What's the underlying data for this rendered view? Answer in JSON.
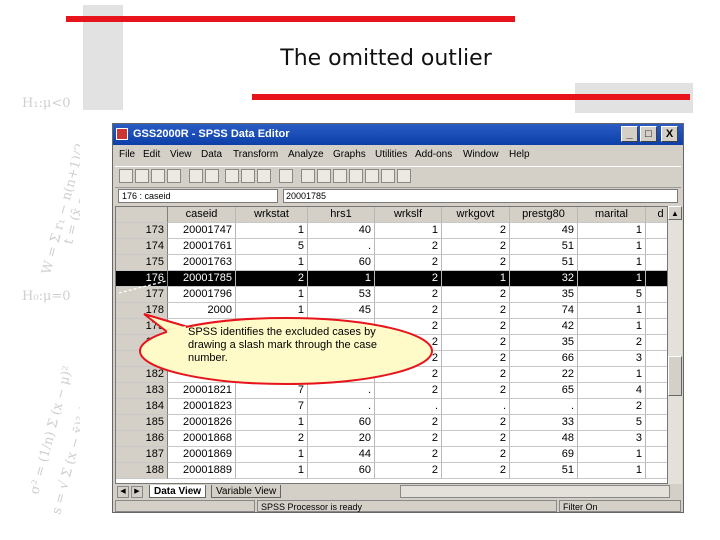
{
  "slide": {
    "title": "The omitted outlier"
  },
  "window": {
    "title": "GSS2000R - SPSS Data Editor",
    "controls": {
      "minimize": "_",
      "maximize": "□",
      "close": "X"
    }
  },
  "menu": [
    "File",
    "Edit",
    "View",
    "Data",
    "Transform",
    "Analyze",
    "Graphs",
    "Utilities",
    "Add-ons",
    "Window",
    "Help"
  ],
  "editor": {
    "cell_ref": "176 : caseid",
    "cell_value": "20001785"
  },
  "columns": [
    "caseid",
    "wrkstat",
    "hrs1",
    "wrkslf",
    "wrkgovt",
    "prestg80",
    "marital",
    "d"
  ],
  "rows": [
    {
      "n": "173",
      "v": [
        "20001747",
        "1",
        "40",
        "1",
        "2",
        "49",
        "1"
      ]
    },
    {
      "n": "174",
      "v": [
        "20001761",
        "5",
        ".",
        "2",
        "2",
        "51",
        "1"
      ]
    },
    {
      "n": "175",
      "v": [
        "20001763",
        "1",
        "60",
        "2",
        "2",
        "51",
        "1"
      ]
    },
    {
      "n": "176",
      "v": [
        "20001785",
        "2",
        "1",
        "2",
        "1",
        "32",
        "1"
      ]
    },
    {
      "n": "177",
      "v": [
        "20001796",
        "1",
        "53",
        "2",
        "2",
        "35",
        "5"
      ]
    },
    {
      "n": "178",
      "v": [
        "2000",
        "1",
        "45",
        "2",
        "2",
        "74",
        "1"
      ]
    },
    {
      "n": "179",
      "v": [
        "",
        "",
        "",
        "2",
        "2",
        "42",
        "1"
      ]
    },
    {
      "n": "180",
      "v": [
        "",
        "",
        "",
        "2",
        "2",
        "35",
        "2"
      ]
    },
    {
      "n": "181",
      "v": [
        "",
        "",
        "",
        "2",
        "2",
        "66",
        "3"
      ]
    },
    {
      "n": "182",
      "v": [
        "",
        "",
        "40",
        "2",
        "2",
        "22",
        "1"
      ]
    },
    {
      "n": "183",
      "v": [
        "20001821",
        "7",
        ".",
        "2",
        "2",
        "65",
        "4"
      ]
    },
    {
      "n": "184",
      "v": [
        "20001823",
        "7",
        ".",
        ".",
        ".",
        ".",
        "2"
      ]
    },
    {
      "n": "185",
      "v": [
        "20001826",
        "1",
        "60",
        "2",
        "2",
        "33",
        "5"
      ]
    },
    {
      "n": "186",
      "v": [
        "20001868",
        "2",
        "20",
        "2",
        "2",
        "48",
        "3"
      ]
    },
    {
      "n": "187",
      "v": [
        "20001869",
        "1",
        "44",
        "2",
        "2",
        "69",
        "1"
      ]
    },
    {
      "n": "188",
      "v": [
        "20001889",
        "1",
        "60",
        "2",
        "2",
        "51",
        "1"
      ]
    }
  ],
  "selected_row": "176",
  "tabs": {
    "data_view": "Data View",
    "variable_view": "Variable View"
  },
  "status": {
    "processor": "SPSS Processor  is ready",
    "filter": "Filter On"
  },
  "callout": {
    "text": "SPSS identifies the excluded cases by drawing a slash mark through the case number."
  },
  "colors": {
    "accent_red": "#e8141c",
    "title_bar_blue": "#0c3fa8",
    "callout_fill": "#fffbc8"
  }
}
